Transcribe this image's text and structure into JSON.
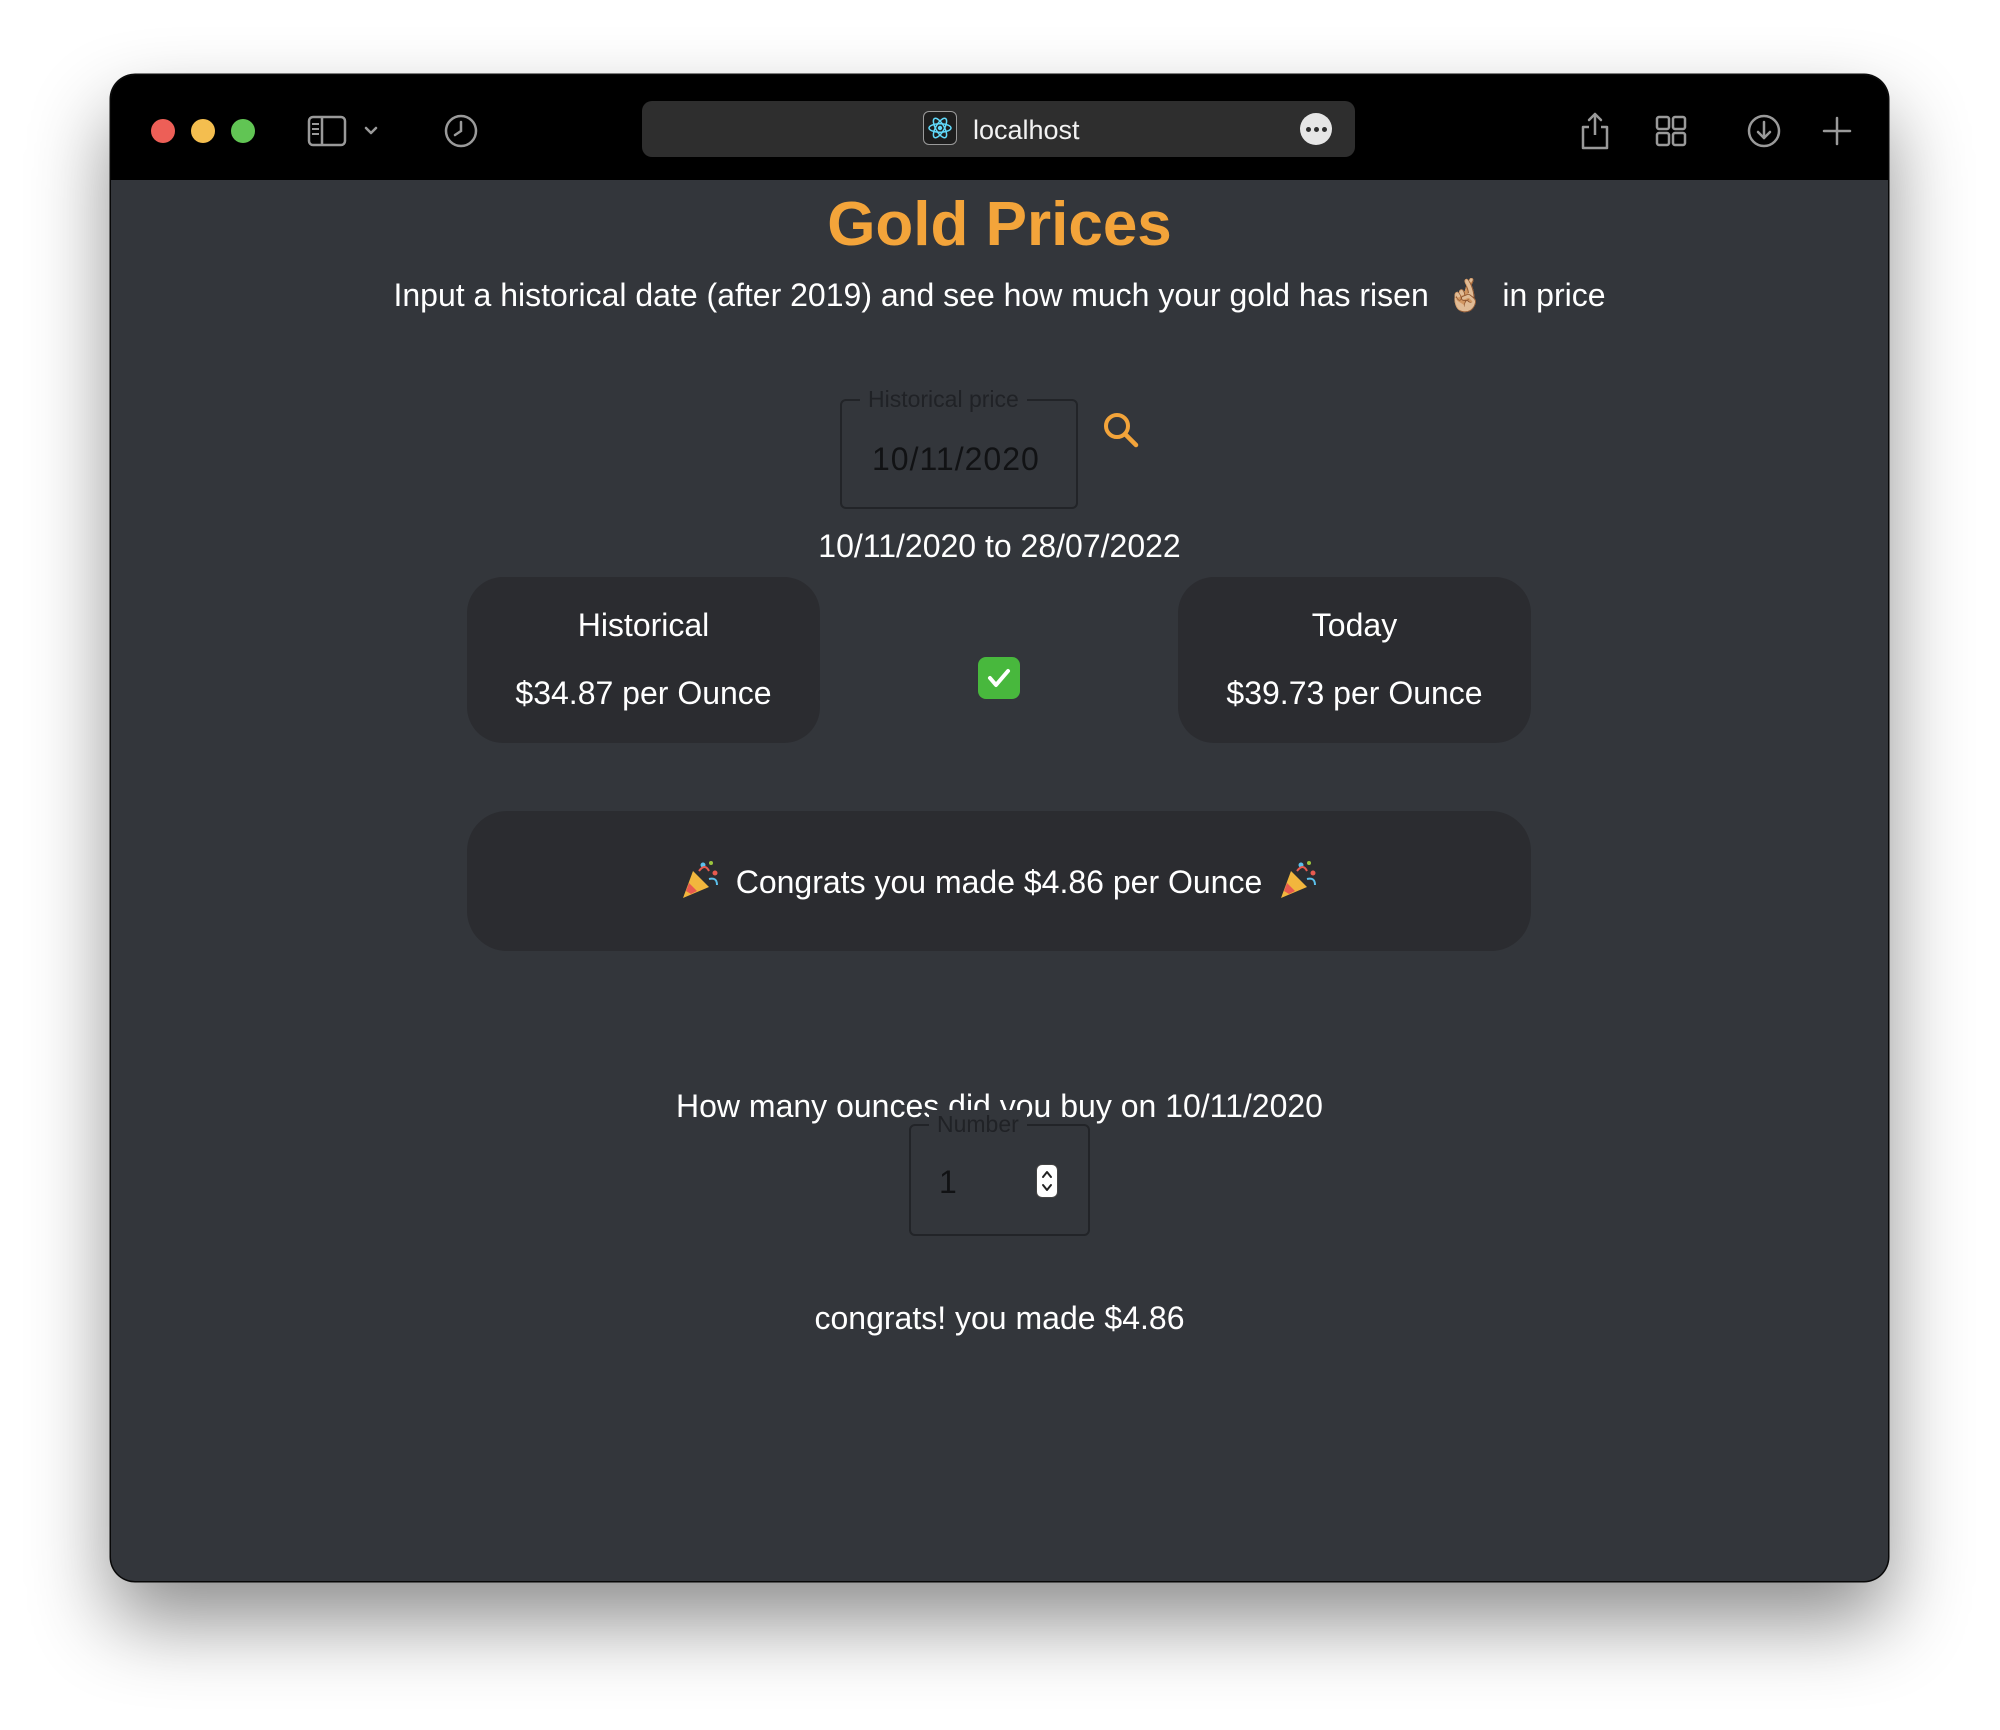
{
  "browser": {
    "url": "localhost",
    "icons": {
      "sidebar": "sidebar-icon",
      "history": "clock-icon",
      "share": "share-icon",
      "tabs": "tab-overview-icon",
      "downloads": "download-icon",
      "new_tab": "plus-icon"
    }
  },
  "page": {
    "title": "Gold Prices",
    "subtitle_before": "Input a historical date (after 2019) and see how much your gold has risen",
    "subtitle_emoji": "🤞🏼",
    "subtitle_after": "in price",
    "date_field": {
      "legend": "Historical price",
      "value": "10/11/2020"
    },
    "range_text": "10/11/2020 to 28/07/2022",
    "historical_card": {
      "label": "Historical",
      "value": "$34.87 per Ounce"
    },
    "today_card": {
      "label": "Today",
      "value": "$39.73 per Ounce"
    },
    "congrats_banner": "Congrats you made $4.86 per Ounce",
    "ounces_question": "How many ounces did you buy on 10/11/2020",
    "number_field": {
      "legend": "Number",
      "value": "1"
    },
    "result_text": "congrats! you made $4.86"
  },
  "colors": {
    "accent": "#f3a43a",
    "background": "#33363b",
    "card": "#2b2c30",
    "check": "#48b83d"
  }
}
